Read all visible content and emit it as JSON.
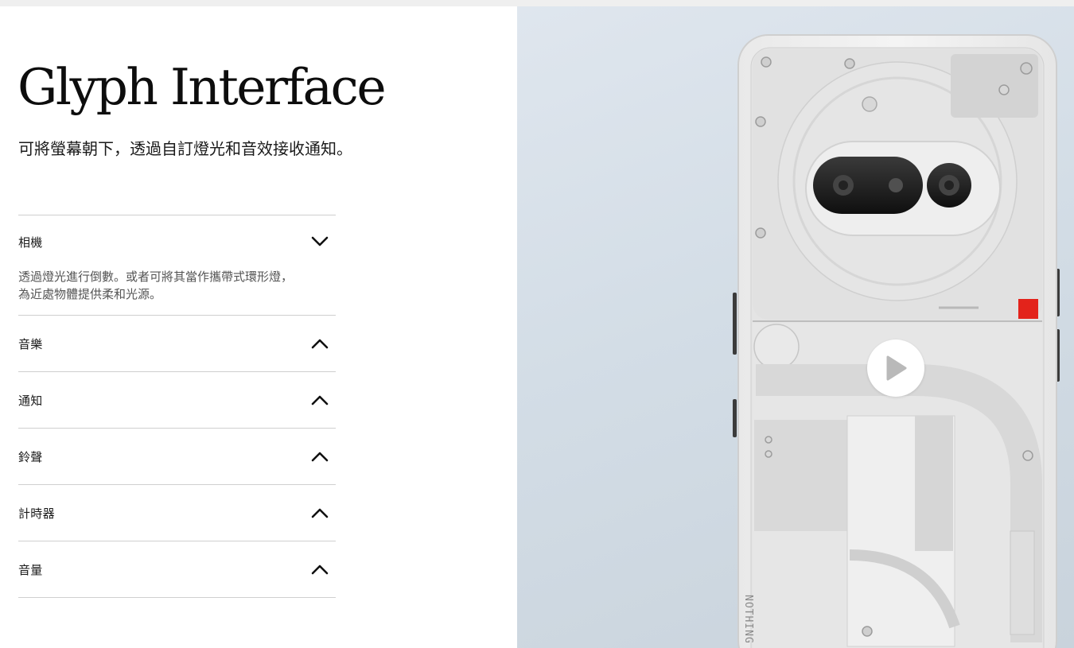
{
  "page": {
    "title": "Glyph Interface",
    "subtitle": "可將螢幕朝下，透過自訂燈光和音效接收通知。"
  },
  "accordion": {
    "items": [
      {
        "label": "相機",
        "expanded": true,
        "chevron": "chevron-down-icon",
        "body": "透過燈光進行倒數。或者可將其當作攜帶式環形燈，為近處物體提供柔和光源。"
      },
      {
        "label": "音樂",
        "expanded": false,
        "chevron": "chevron-up-icon"
      },
      {
        "label": "通知",
        "expanded": false,
        "chevron": "chevron-up-icon"
      },
      {
        "label": "鈴聲",
        "expanded": false,
        "chevron": "chevron-up-icon"
      },
      {
        "label": "計時器",
        "expanded": false,
        "chevron": "chevron-up-icon"
      },
      {
        "label": "音量",
        "expanded": false,
        "chevron": "chevron-up-icon"
      }
    ]
  },
  "media": {
    "play_icon": "play-icon",
    "phone_brand_text": "NOTHING",
    "accent_color": "#e3231b",
    "background_color": "#d6dfe7"
  }
}
